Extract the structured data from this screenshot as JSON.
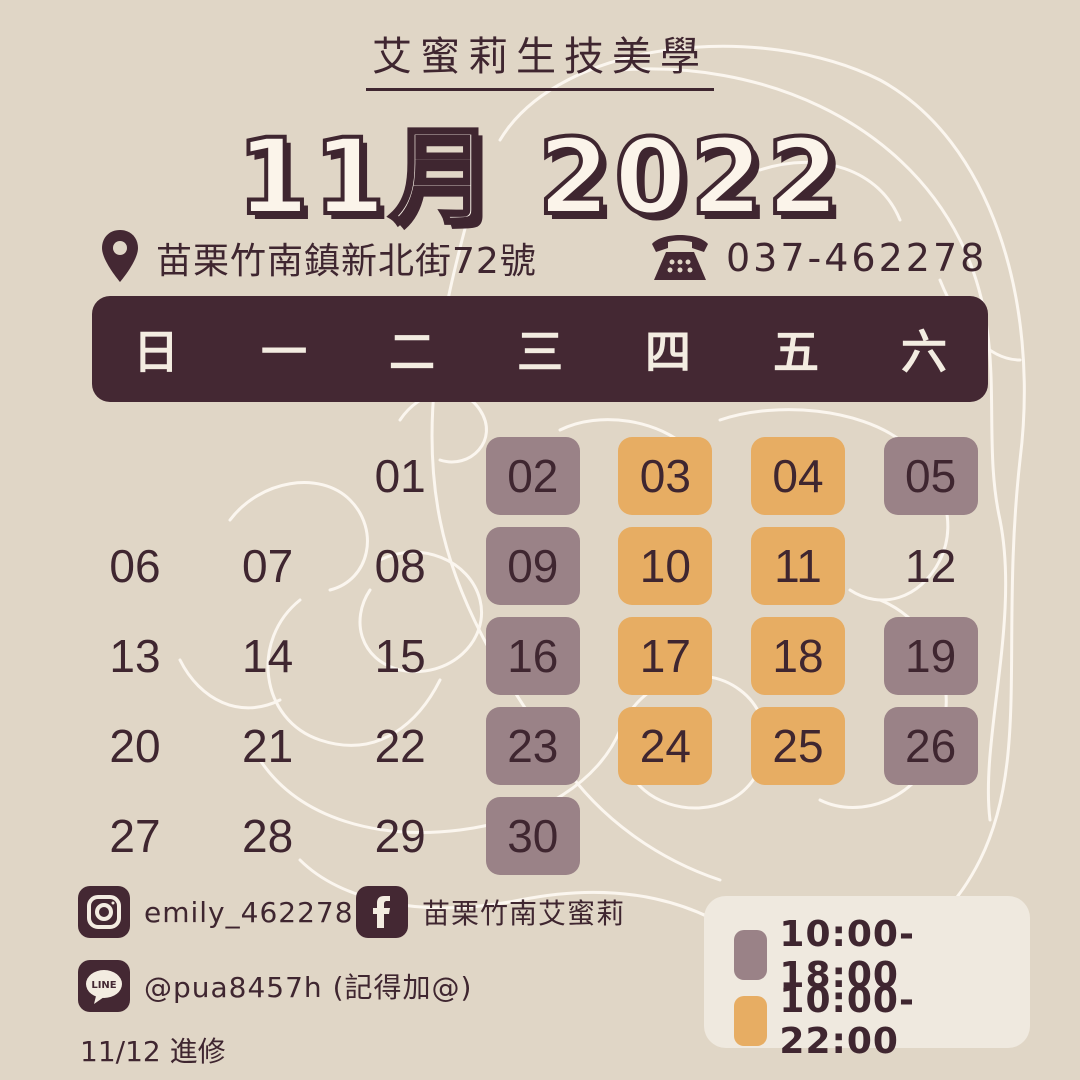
{
  "header": {
    "brand": "艾蜜莉生技美學",
    "month_title": "11月 2022"
  },
  "contact": {
    "address": "苗栗竹南鎮新北街72號",
    "phone": "037-462278"
  },
  "weekdays": [
    "日",
    "一",
    "二",
    "三",
    "四",
    "五",
    "六"
  ],
  "calendar": {
    "days": [
      {
        "label": "01",
        "col": 2,
        "row": 0,
        "status": "none"
      },
      {
        "label": "02",
        "col": 3,
        "row": 0,
        "status": "day"
      },
      {
        "label": "03",
        "col": 4,
        "row": 0,
        "status": "evening"
      },
      {
        "label": "04",
        "col": 5,
        "row": 0,
        "status": "evening"
      },
      {
        "label": "05",
        "col": 6,
        "row": 0,
        "status": "day"
      },
      {
        "label": "06",
        "col": 0,
        "row": 1,
        "status": "none"
      },
      {
        "label": "07",
        "col": 1,
        "row": 1,
        "status": "none"
      },
      {
        "label": "08",
        "col": 2,
        "row": 1,
        "status": "none"
      },
      {
        "label": "09",
        "col": 3,
        "row": 1,
        "status": "day"
      },
      {
        "label": "10",
        "col": 4,
        "row": 1,
        "status": "evening"
      },
      {
        "label": "11",
        "col": 5,
        "row": 1,
        "status": "evening"
      },
      {
        "label": "12",
        "col": 6,
        "row": 1,
        "status": "none"
      },
      {
        "label": "13",
        "col": 0,
        "row": 2,
        "status": "none"
      },
      {
        "label": "14",
        "col": 1,
        "row": 2,
        "status": "none"
      },
      {
        "label": "15",
        "col": 2,
        "row": 2,
        "status": "none"
      },
      {
        "label": "16",
        "col": 3,
        "row": 2,
        "status": "day"
      },
      {
        "label": "17",
        "col": 4,
        "row": 2,
        "status": "evening"
      },
      {
        "label": "18",
        "col": 5,
        "row": 2,
        "status": "evening"
      },
      {
        "label": "19",
        "col": 6,
        "row": 2,
        "status": "day"
      },
      {
        "label": "20",
        "col": 0,
        "row": 3,
        "status": "none"
      },
      {
        "label": "21",
        "col": 1,
        "row": 3,
        "status": "none"
      },
      {
        "label": "22",
        "col": 2,
        "row": 3,
        "status": "none"
      },
      {
        "label": "23",
        "col": 3,
        "row": 3,
        "status": "day"
      },
      {
        "label": "24",
        "col": 4,
        "row": 3,
        "status": "evening"
      },
      {
        "label": "25",
        "col": 5,
        "row": 3,
        "status": "evening"
      },
      {
        "label": "26",
        "col": 6,
        "row": 3,
        "status": "day"
      },
      {
        "label": "27",
        "col": 0,
        "row": 4,
        "status": "none"
      },
      {
        "label": "28",
        "col": 1,
        "row": 4,
        "status": "none"
      },
      {
        "label": "29",
        "col": 2,
        "row": 4,
        "status": "none"
      },
      {
        "label": "30",
        "col": 3,
        "row": 4,
        "status": "day"
      }
    ]
  },
  "social": {
    "instagram": "emily_462278",
    "facebook": "苗栗竹南艾蜜莉",
    "line": "@pua8457h (記得加@)",
    "line_badge": "LINE"
  },
  "note": "11/12 進修",
  "legend": {
    "day_hours": "10:00-18:00",
    "evening_hours": "10:00-22:00"
  },
  "colors": {
    "background": "#e0d6c6",
    "dark": "#442833",
    "text": "#3f2630",
    "mauve": "#9a8287",
    "amber": "#e7ad63"
  },
  "icons": [
    "map-pin-icon",
    "telephone-icon",
    "instagram-icon",
    "facebook-icon",
    "line-icon"
  ]
}
